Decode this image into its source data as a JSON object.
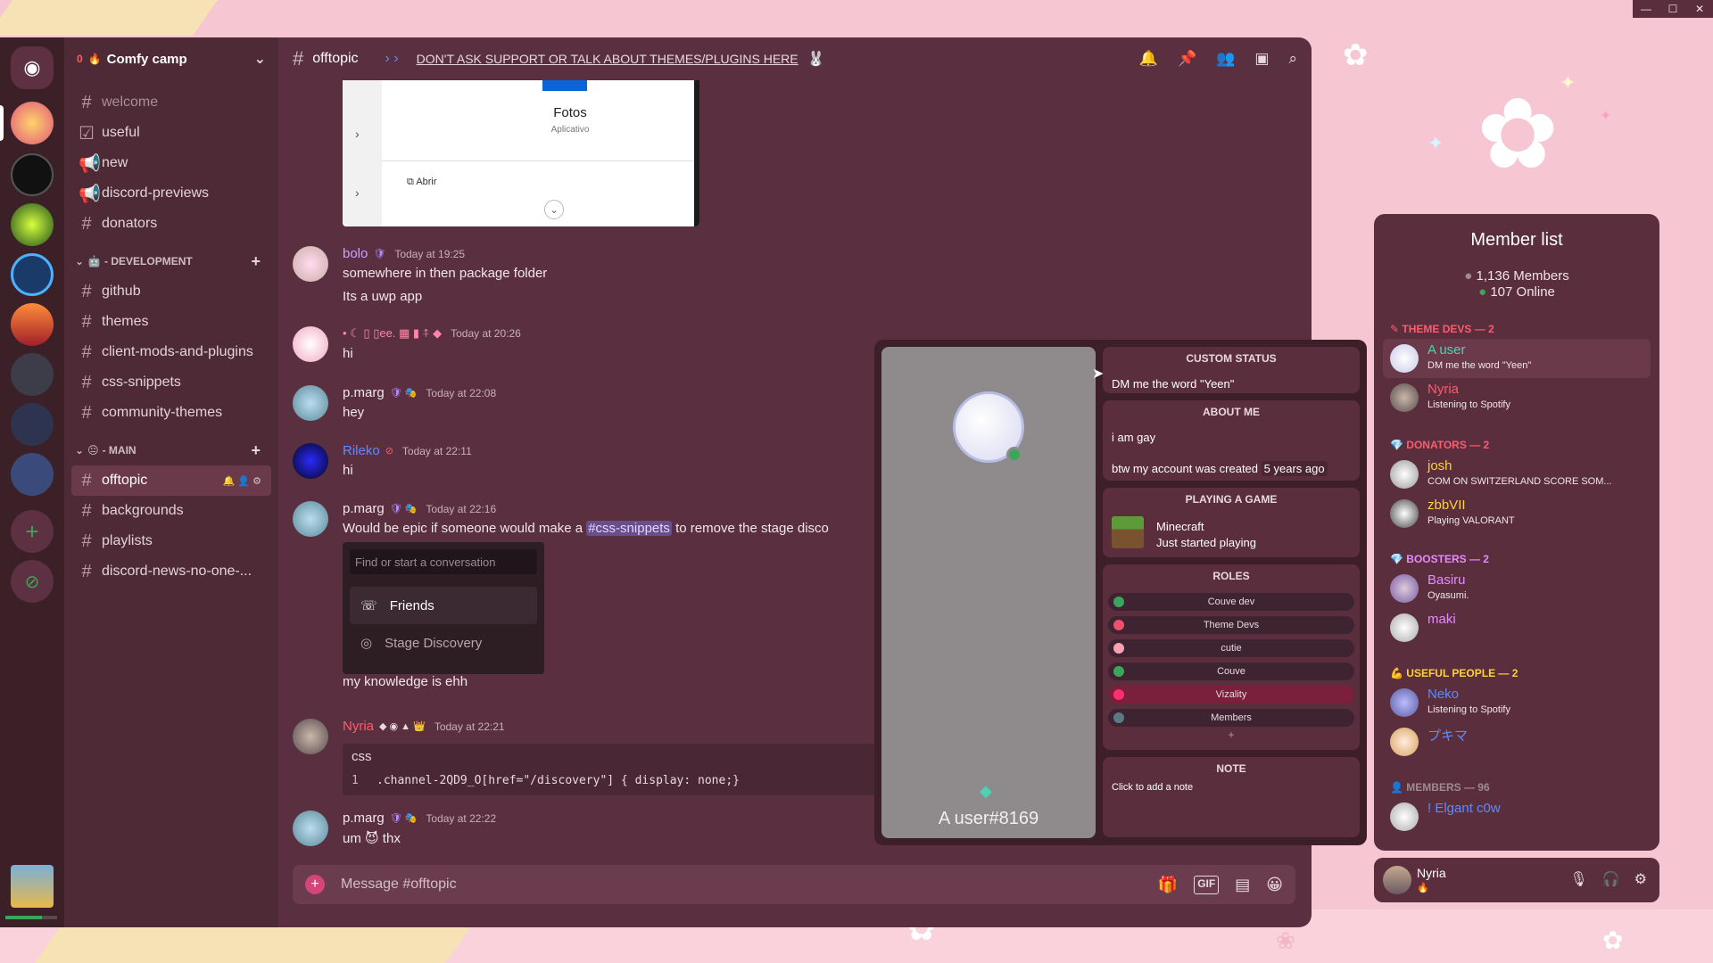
{
  "window_controls": [
    "—",
    "☐",
    "✕"
  ],
  "server": {
    "name": "Comfy camp",
    "badge": "0"
  },
  "sidebar": {
    "channels_top": [
      {
        "label": "welcome",
        "icon": "hash-icon",
        "muted": true
      },
      {
        "label": "useful",
        "icon": "checkbox-icon"
      },
      {
        "label": "new",
        "icon": "megaphone-icon"
      },
      {
        "label": "discord-previews",
        "icon": "megaphone-icon"
      },
      {
        "label": "donators",
        "icon": "hash-icon"
      }
    ],
    "category_dev": "- DEVELOPMENT",
    "channels_dev": [
      "github",
      "themes",
      "client-mods-and-plugins",
      "css-snippets",
      "community-themes"
    ],
    "category_main": "- MAIN",
    "channels_main": [
      "offtopic",
      "backgrounds",
      "playlists",
      "discord-news-no-one-..."
    ]
  },
  "header": {
    "channel": "offtopic",
    "topic": "DON'T ASK SUPPORT OR TALK ABOUT THEMES/PLUGINS HERE"
  },
  "attachment": {
    "title": "Fotos",
    "subtitle": "Aplicativo",
    "action": "Abrir"
  },
  "messages": {
    "m1": {
      "author": "bolo",
      "time": "Today at 19:25",
      "lines": [
        "somewhere in then package folder",
        "Its a uwp app"
      ]
    },
    "m2": {
      "author": "• ☾ ▯ ▯ee. ▦ ▮ ⍏ ◆",
      "time": "Today at 20:26",
      "lines": [
        "hi"
      ]
    },
    "m3": {
      "author": "p.marg",
      "time": "Today at 22:08",
      "lines": [
        "hey"
      ]
    },
    "m4": {
      "author": "Rileko",
      "time": "Today at 22:11",
      "lines": [
        "hi"
      ]
    },
    "m5": {
      "author": "p.marg",
      "time": "Today at 22:16",
      "pre": "Would be epic if someone would make a",
      "mention": "#css-snippets",
      "post": "to remove the stage disco",
      "after": "my knowledge is ehh"
    },
    "m6": {
      "author": "Nyria",
      "time": "Today at 22:21",
      "code_lang": "css",
      "code_ln": "1",
      "code": ".channel-2QD9_O[href=\"/discovery\"] { display: none;}"
    },
    "m7": {
      "author": "p.marg",
      "time": "Today at 22:22",
      "lines": [
        "um 😈 thx"
      ]
    }
  },
  "dm_popup": {
    "search_placeholder": "Find or start a conversation",
    "friends": "Friends",
    "stage": "Stage Discovery"
  },
  "composer": {
    "placeholder": "Message #offtopic",
    "gif": "GIF"
  },
  "profile": {
    "username": "A user#8169",
    "custom_status_h": "CUSTOM STATUS",
    "custom_status": "DM me the word \"Yeen\"",
    "about_h": "ABOUT ME",
    "about_1": "i am gay",
    "about_2": "btw my account was created",
    "about_2_tag": "5 years ago",
    "game_h": "PLAYING A GAME",
    "game_name": "Minecraft",
    "game_detail": "Just started playing",
    "roles_h": "ROLES",
    "roles": [
      {
        "label": "Couve dev",
        "color": "#3ba55c"
      },
      {
        "label": "Theme Devs",
        "color": "#f0506e"
      },
      {
        "label": "cutie",
        "color": "#f7a1b4"
      },
      {
        "label": "Couve",
        "color": "#3ba55c"
      },
      {
        "label": "Vizality",
        "color": "#ff2f6e"
      },
      {
        "label": "Members",
        "color": "#5c7a86"
      }
    ],
    "roles_add": "+",
    "note_h": "NOTE",
    "note_placeholder": "Click to add a note"
  },
  "member_list": {
    "title": "Member list",
    "members_total": "1,136 Members",
    "online": "107 Online",
    "groups": {
      "theme_devs": "THEME DEVS — 2",
      "donators": "DONATORS — 2",
      "boosters": "BOOSTERS — 2",
      "useful": "USEFUL PEOPLE — 2",
      "members": "MEMBERS — 96"
    },
    "items": [
      {
        "name": "A user",
        "status": "DM me the word \"Yeen\""
      },
      {
        "name": "Nyria",
        "status": "Listening to Spotify"
      },
      {
        "name": "josh",
        "status": "COM ON SWITZERLAND SCORE SOM..."
      },
      {
        "name": "zbbVII",
        "status": "Playing VALORANT"
      },
      {
        "name": "Basiru",
        "status": "Oyasumi."
      },
      {
        "name": "maki",
        "status": ""
      },
      {
        "name": "Neko",
        "status": "Listening to Spotify"
      },
      {
        "name": "プキマ",
        "status": ""
      },
      {
        "name": "! Elgant c0w",
        "status": ""
      }
    ]
  },
  "user_bar": {
    "name": "Nyria"
  },
  "colors": {
    "accent": "#5a2e3d",
    "background": "#f7c6d3",
    "online": "#3ba55c",
    "mention": "#6a4e8c"
  }
}
